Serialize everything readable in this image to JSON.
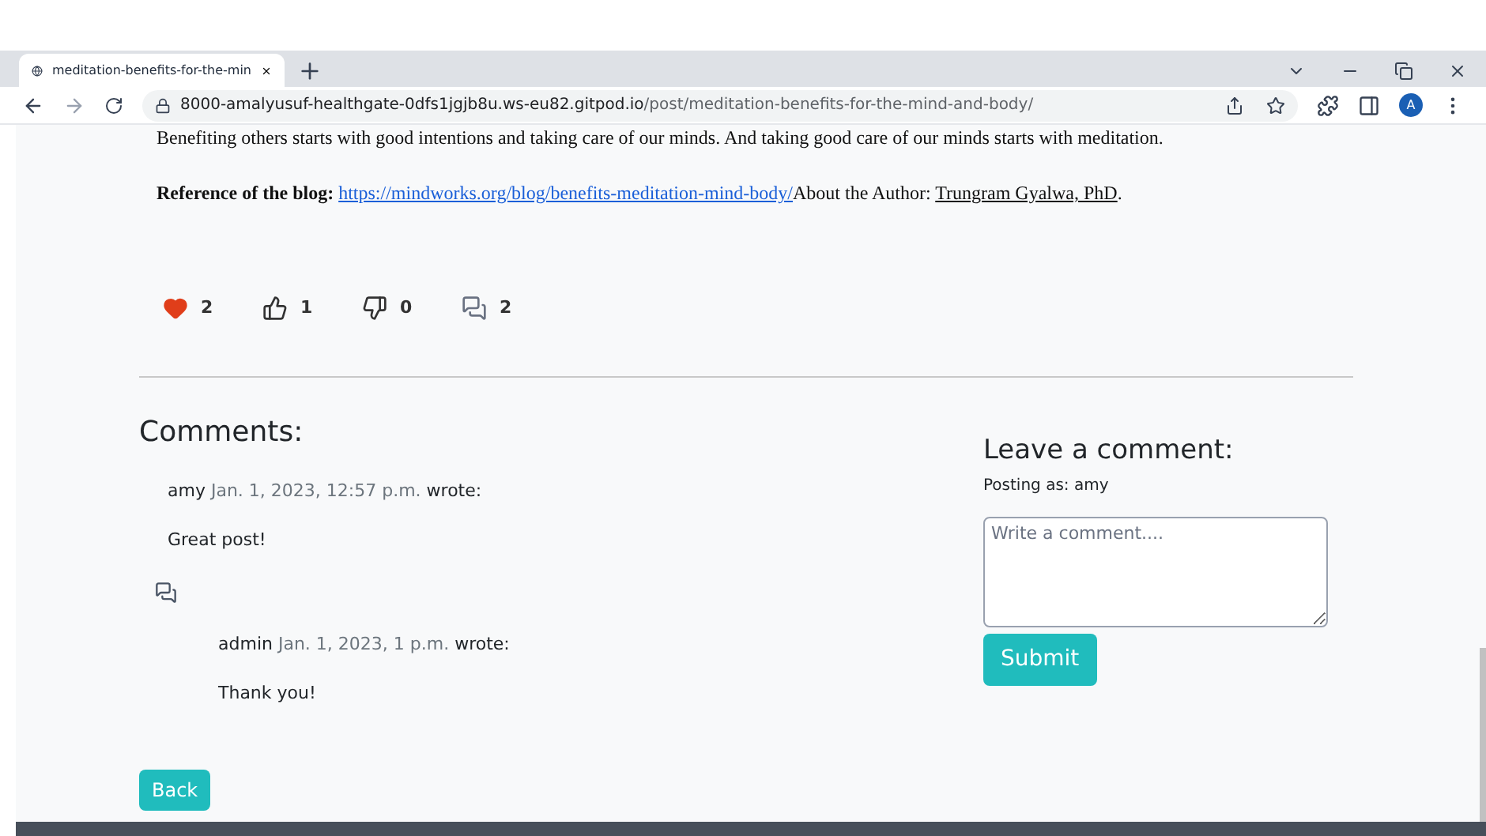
{
  "browser": {
    "tab": {
      "title": "meditation-benefits-for-the-min",
      "selected": true
    },
    "address": {
      "host": "8000-amalyusuf-healthgate-0dfs1jgjb8u.ws-eu82.gitpod.io",
      "path": "/post/meditation-benefits-for-the-mind-and-body/"
    },
    "profile": "A"
  },
  "post": {
    "closing_text": "Benefiting others starts with good intentions and taking care of our minds. And taking good care of our minds starts with meditation.",
    "reference": {
      "label": "Reference of the blog:",
      "link": "https://mindworks.org/blog/benefits-meditation-mind-body/",
      "author_label": "About the Author:",
      "author": "Trungram Gyalwa, PhD",
      "end": "."
    },
    "stats": [
      {
        "kind": "likes",
        "count": "2"
      },
      {
        "kind": "thumbs_up",
        "count": "1"
      },
      {
        "kind": "thumbs_down",
        "count": "0"
      },
      {
        "kind": "comments",
        "count": "2"
      }
    ]
  },
  "comments": {
    "heading": "Comments:",
    "items": [
      {
        "author": "amy",
        "date": "Jan. 1, 2023, 12:57 p.m.",
        "suffix": "wrote:",
        "body": "Great post!",
        "children": [
          {
            "author": "admin",
            "date": "Jan. 1, 2023, 1 p.m.",
            "suffix": "wrote:",
            "body": "Thank you!"
          }
        ]
      }
    ]
  },
  "form": {
    "heading": "Leave a comment:",
    "posting_as": "Posting as: amy",
    "placeholder": "Write a comment....",
    "submit": "Submit"
  },
  "back": "Back"
}
